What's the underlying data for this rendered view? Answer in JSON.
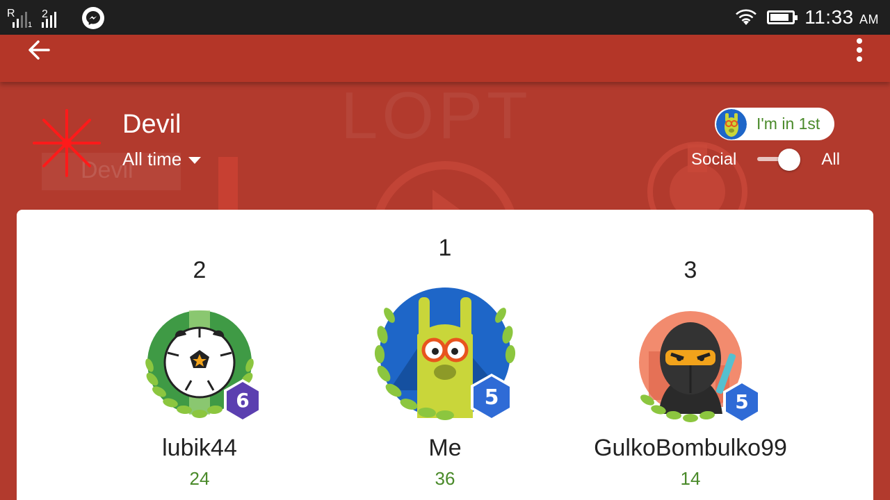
{
  "status_bar": {
    "sim1_label": "R",
    "sim1_slot": "1",
    "sim2_slot": "2",
    "time": "11:33",
    "ampm": "AM",
    "icons": [
      "signal-icon",
      "messenger-icon",
      "wifi-icon",
      "battery-icon"
    ]
  },
  "app_bar": {
    "icons": [
      "back-arrow-icon",
      "more-vert-icon"
    ]
  },
  "header": {
    "background_text": "LOPT",
    "ghost_label": "Devil",
    "title": "Devil",
    "period": "All time",
    "rank_chip": "I'm in 1st",
    "filter_left": "Social",
    "filter_right": "All",
    "filter_selected": "All"
  },
  "leaderboard": [
    {
      "rank": "2",
      "name": "lubik44",
      "score": "24",
      "level": "6",
      "avatar": "soccer-ball-avatar",
      "level_color": "#5b3fb0"
    },
    {
      "rank": "1",
      "name": "Me",
      "score": "36",
      "level": "5",
      "avatar": "llama-avatar",
      "level_color": "#2f6bd6"
    },
    {
      "rank": "3",
      "name": "GulkoBombulko99",
      "score": "14",
      "level": "5",
      "avatar": "ninja-avatar",
      "level_color": "#2f6bd6"
    }
  ],
  "colors": {
    "header_red": "#b23a2d",
    "app_bar_red": "#b43628",
    "accent_green": "#4a8a2a",
    "devil_icon_red": "#ff1a1a"
  }
}
